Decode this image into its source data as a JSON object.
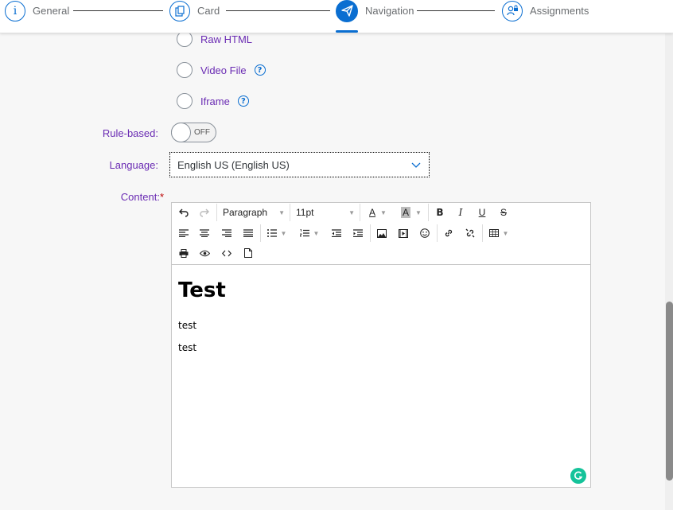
{
  "wizard": {
    "steps": [
      {
        "label": "General",
        "icon": "info-icon"
      },
      {
        "label": "Card",
        "icon": "card-icon"
      },
      {
        "label": "Navigation",
        "icon": "paper-plane-icon"
      },
      {
        "label": "Assignments",
        "icon": "user-lock-icon"
      }
    ],
    "active_step": "Navigation"
  },
  "content_type_options": [
    {
      "label": "Raw HTML",
      "help": false
    },
    {
      "label": "Video File",
      "help": true
    },
    {
      "label": "Iframe",
      "help": true
    }
  ],
  "rule_based": {
    "label": "Rule-based:",
    "toggle_text": "OFF"
  },
  "language": {
    "label": "Language:",
    "value": "English US (English US)"
  },
  "content": {
    "label": "Content:",
    "required_mark": "*"
  },
  "editor": {
    "toolbar": {
      "block_format": "Paragraph",
      "font_size": "11pt"
    },
    "body": {
      "heading": "Test",
      "paragraphs": [
        "test",
        "test"
      ]
    }
  },
  "colors": {
    "accent": "#0a6ed1",
    "label": "#6a2bb3",
    "required": "#bb0000",
    "grammarly": "#15c39a"
  }
}
